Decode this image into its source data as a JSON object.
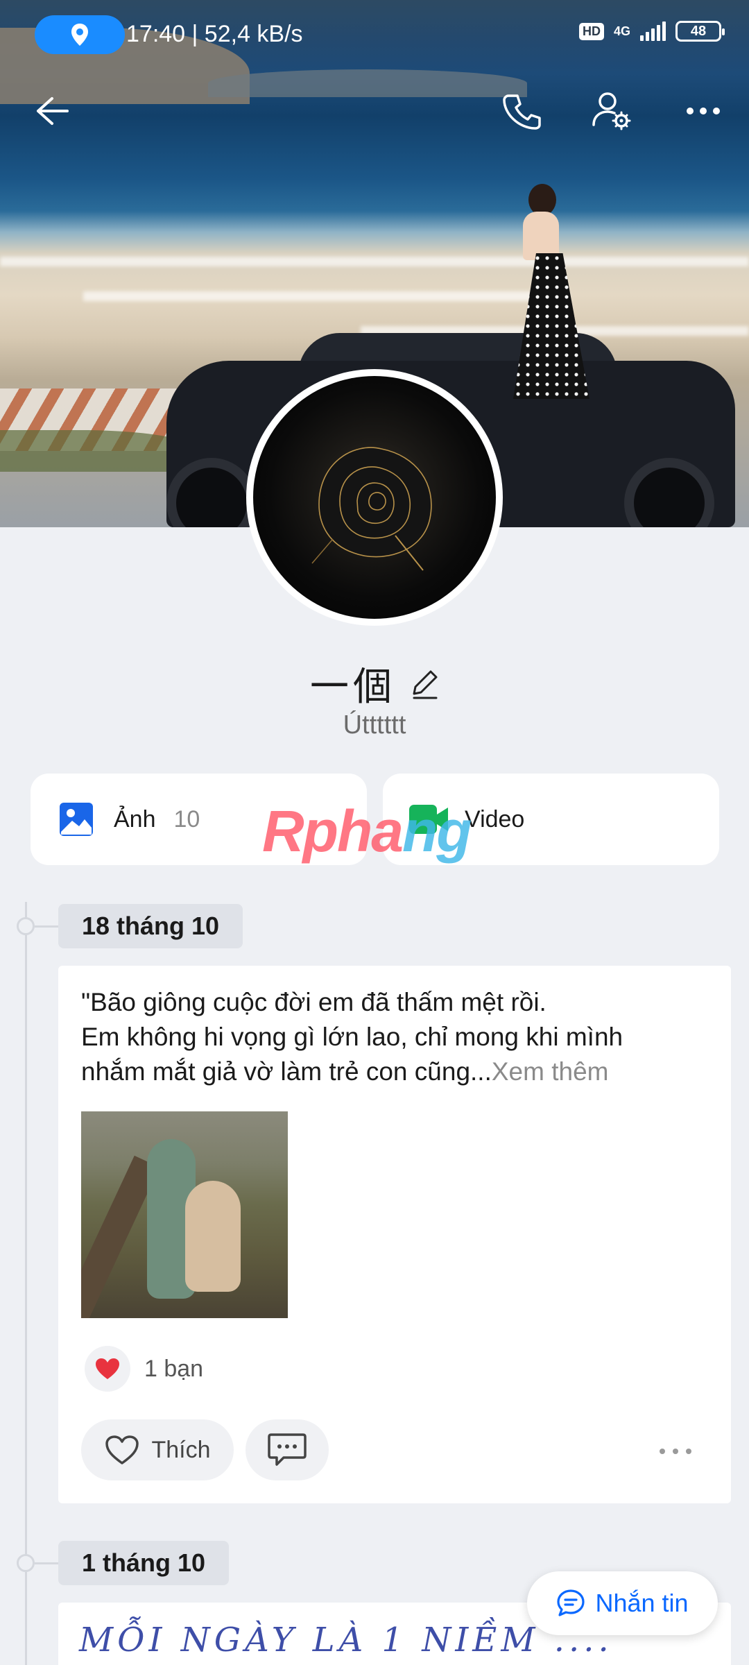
{
  "status_bar": {
    "time_speed": "17:40 | 52,4 kB/s",
    "hd": "HD",
    "network": "4G",
    "battery": "48"
  },
  "profile": {
    "name": "一個",
    "subtitle": "Útttttt"
  },
  "media": {
    "photos_label": "Ảnh",
    "photos_count": "10",
    "video_label": "Video"
  },
  "watermark": {
    "part1": "Rpha",
    "part2": "ng"
  },
  "timeline": [
    {
      "date": "18 tháng 10",
      "text_lines": [
        "\"Bão giông cuộc đời em đã thấm mệt rồi.",
        "Em không hi vọng gì lớn lao, chỉ mong khi mình",
        "nhắm mắt giả vờ làm trẻ con cũng..."
      ],
      "see_more": "Xem thêm",
      "reaction_count": "1 bạn",
      "like_label": "Thích"
    },
    {
      "date": "1 tháng 10",
      "preview": "MỖI NGÀY LÀ 1 NIỀM ...."
    }
  ],
  "message_button": "Nhắn tin",
  "colors": {
    "accent": "#0a68ff",
    "heart": "#e8333f",
    "location_pill": "#1a8cff"
  },
  "icons": [
    "location-icon",
    "back-icon",
    "phone-icon",
    "user-settings-icon",
    "more-icon",
    "image-icon",
    "video-icon",
    "heart-icon",
    "comment-icon",
    "message-icon",
    "edit-icon"
  ]
}
